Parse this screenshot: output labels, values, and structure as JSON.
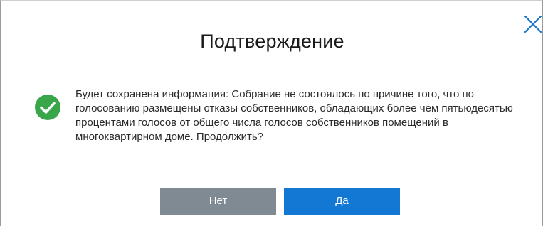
{
  "dialog": {
    "title": "Подтверждение",
    "message": "Будет сохранена информация: Собрание не состоялось по причине того, что по голосованию размещены отказы собственников, обладающих более чем пятьюдесятью процентами голосов от общего числа голосов собственников помещений в многоквартирном доме. Продолжить?",
    "icon": "check-circle-icon",
    "close_icon": "close-icon",
    "buttons": {
      "no_label": "Нет",
      "yes_label": "Да"
    }
  },
  "colors": {
    "accent": "#1378d4",
    "secondary_button": "#7f8a93",
    "success": "#3aa64a",
    "close_icon": "#1a73c7"
  }
}
